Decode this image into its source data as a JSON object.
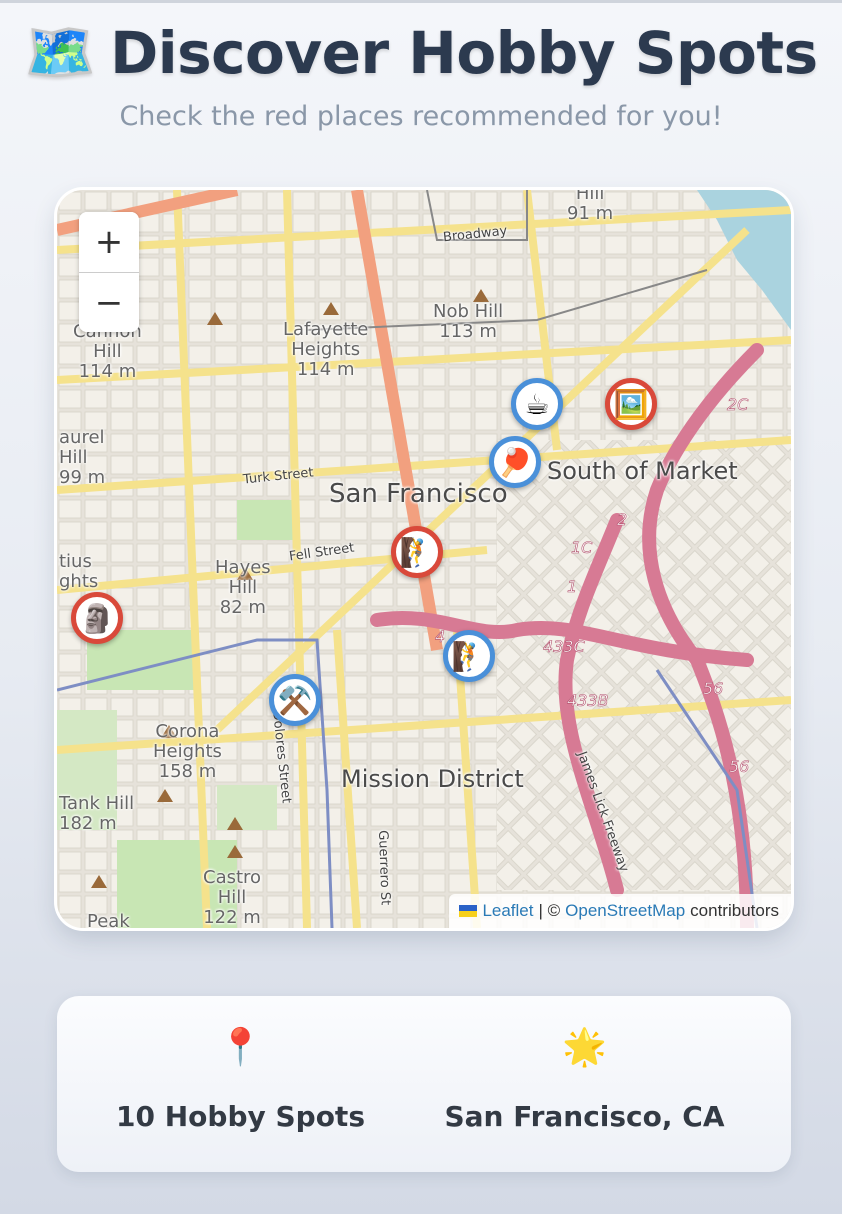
{
  "header": {
    "icon": "🗺️",
    "title": "Discover Hobby Spots",
    "subtitle": "Check the red places recommended for you!"
  },
  "map": {
    "zoom_in_label": "+",
    "zoom_out_label": "−",
    "places": {
      "san_francisco": "San Francisco",
      "south_of_market": "South of Market",
      "mission_district": "Mission District",
      "nob_hill": "Nob Hill",
      "nob_hill_elev": "113 m",
      "lafayette": "Lafayette",
      "heights": "Heights",
      "lafayette_elev": "114 m",
      "cannon": "Cannon",
      "hill": "Hill",
      "cannon_elev": "114 m",
      "laurel": "aurel",
      "laurel_hill": "Hill",
      "laurel_elev": "99 m",
      "hayes": "Hayes",
      "hayes_hill": "Hill",
      "hayes_elev": "82 m",
      "corona": "Corona",
      "corona_heights": "Heights",
      "corona_elev": "158 m",
      "tank_hill": "Tank Hill",
      "tank_elev": "182 m",
      "castro": "Castro",
      "castro_hill": "Hill",
      "castro_elev": "122 m",
      "peak": "Peak",
      "tius": "tius",
      "ghts": "ghts",
      "top_hill": "Hill",
      "top_elev": "91 m"
    },
    "streets": {
      "broadway": "Broadway",
      "turk": "Turk Street",
      "fell": "Fell Street",
      "dolores": "Dolores Street",
      "guerrero": "Guerrero St",
      "james_lick": "James Lick Freeway"
    },
    "shields": [
      "2C",
      "2",
      "1C",
      "1",
      "433C",
      "433B",
      "56",
      "56",
      "4"
    ],
    "markers": [
      {
        "name": "coffee",
        "icon": "☕",
        "color": "blue"
      },
      {
        "name": "art-gallery",
        "icon": "🖼️",
        "color": "red"
      },
      {
        "name": "ping-pong",
        "icon": "🏓",
        "color": "blue"
      },
      {
        "name": "climbing-red",
        "icon": "🧗",
        "color": "red"
      },
      {
        "name": "moai",
        "icon": "🗿",
        "color": "red"
      },
      {
        "name": "climbing-blue",
        "icon": "🧗",
        "color": "blue"
      },
      {
        "name": "tools",
        "icon": "⚒️",
        "color": "blue"
      }
    ],
    "attribution": {
      "leaflet": "Leaflet",
      "separator": "| ©",
      "osm": "OpenStreetMap",
      "contributors": "contributors"
    }
  },
  "stats": {
    "spots_icon": "📍",
    "spots_label": "10 Hobby Spots",
    "location_icon": "🌟",
    "location_label": "San Francisco, CA"
  }
}
